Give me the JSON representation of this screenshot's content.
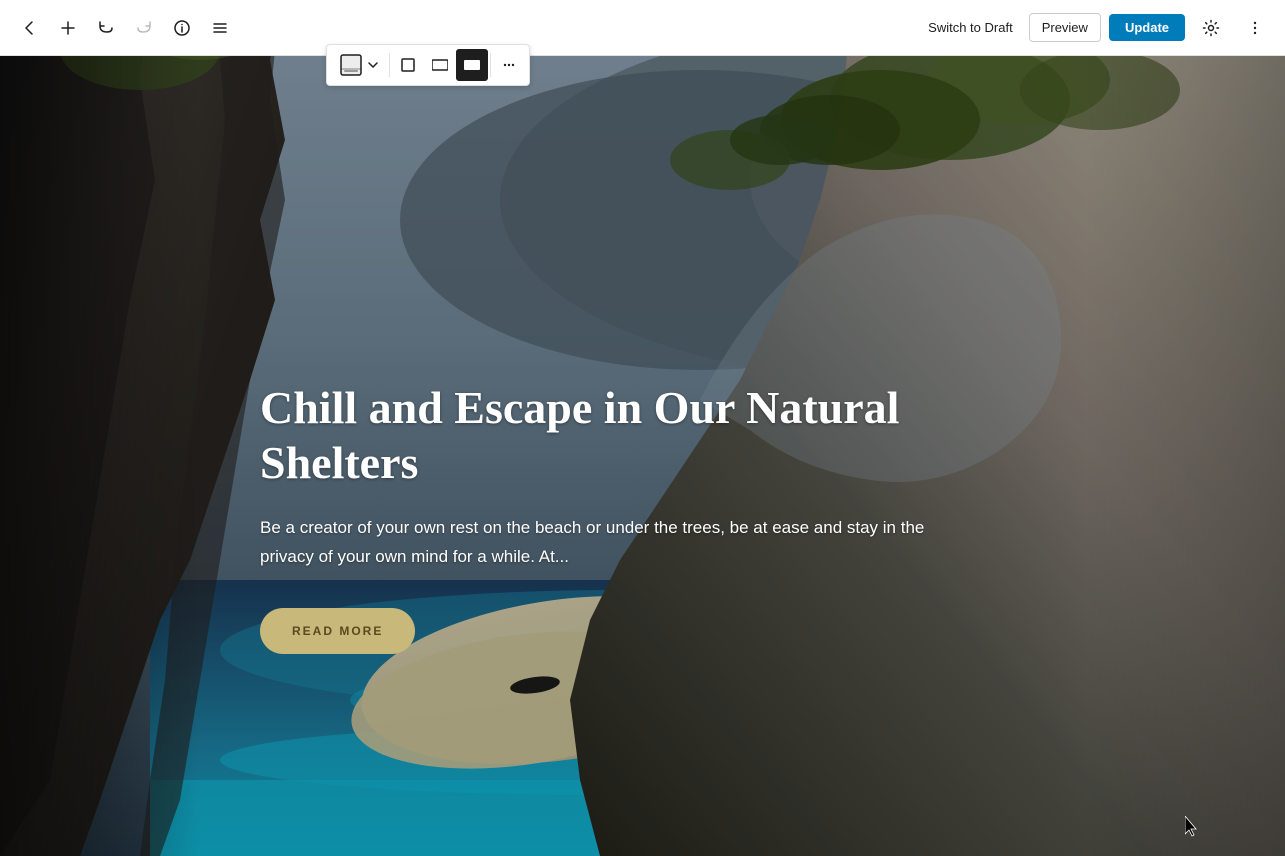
{
  "toolbar": {
    "back_label": "←",
    "add_label": "+",
    "undo_label": "↩",
    "redo_label": "↪",
    "info_label": "ℹ",
    "list_label": "≡",
    "switch_to_draft_label": "Switch to Draft",
    "preview_label": "Preview",
    "update_label": "Update"
  },
  "block_toolbar": {
    "block_type_icon": "▦",
    "block_type_chevron": "▾",
    "align_full_label": "⬜",
    "align_wide_label": "⬜",
    "align_full_active": true,
    "more_label": "⋮"
  },
  "hero": {
    "title": "Chill and Escape in Our Natural Shelters",
    "description": "Be a creator of your own rest on the beach or under the trees, be at ease and stay in the privacy of your own mind for a while. At...",
    "read_more_label": "READ MORE"
  }
}
